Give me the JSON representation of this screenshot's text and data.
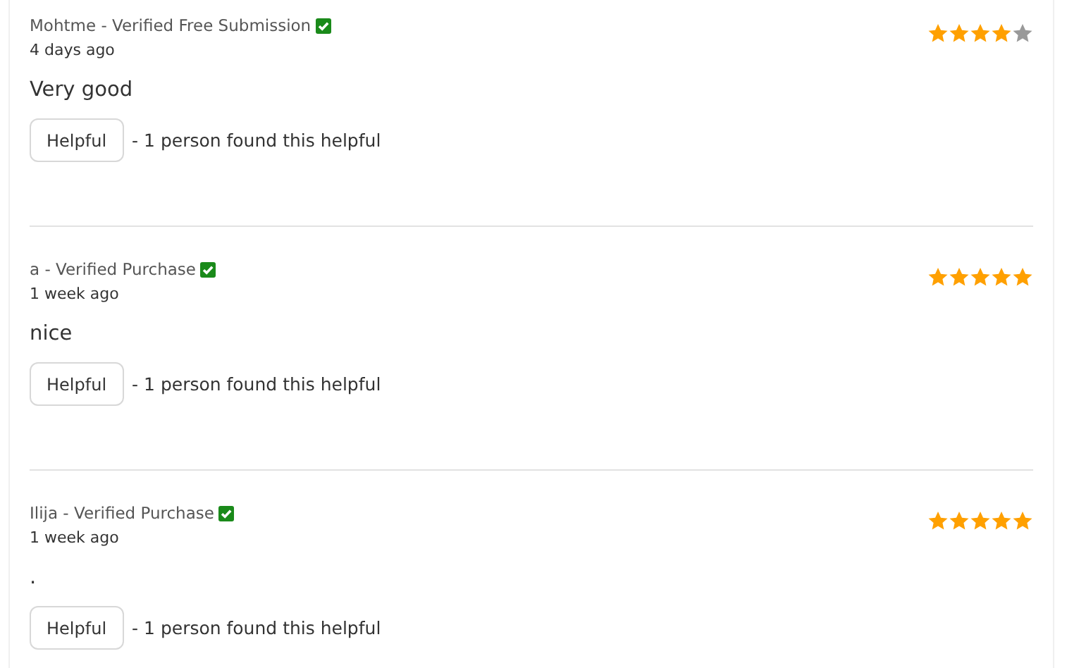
{
  "reviews": [
    {
      "author": "Mohtme - Verified Free Submission",
      "date": "4 days ago",
      "stars": 4,
      "text": "Very good",
      "button": "Helpful",
      "helpful": "- 1 person found this helpful"
    },
    {
      "author": "a - Verified Purchase",
      "date": "1 week ago",
      "stars": 5,
      "text": "nice",
      "button": "Helpful",
      "helpful": "- 1 person found this helpful"
    },
    {
      "author": "Ilija - Verified Purchase",
      "date": "1 week ago",
      "stars": 5,
      "text": ".",
      "button": "Helpful",
      "helpful": "- 1 person found this helpful"
    }
  ]
}
